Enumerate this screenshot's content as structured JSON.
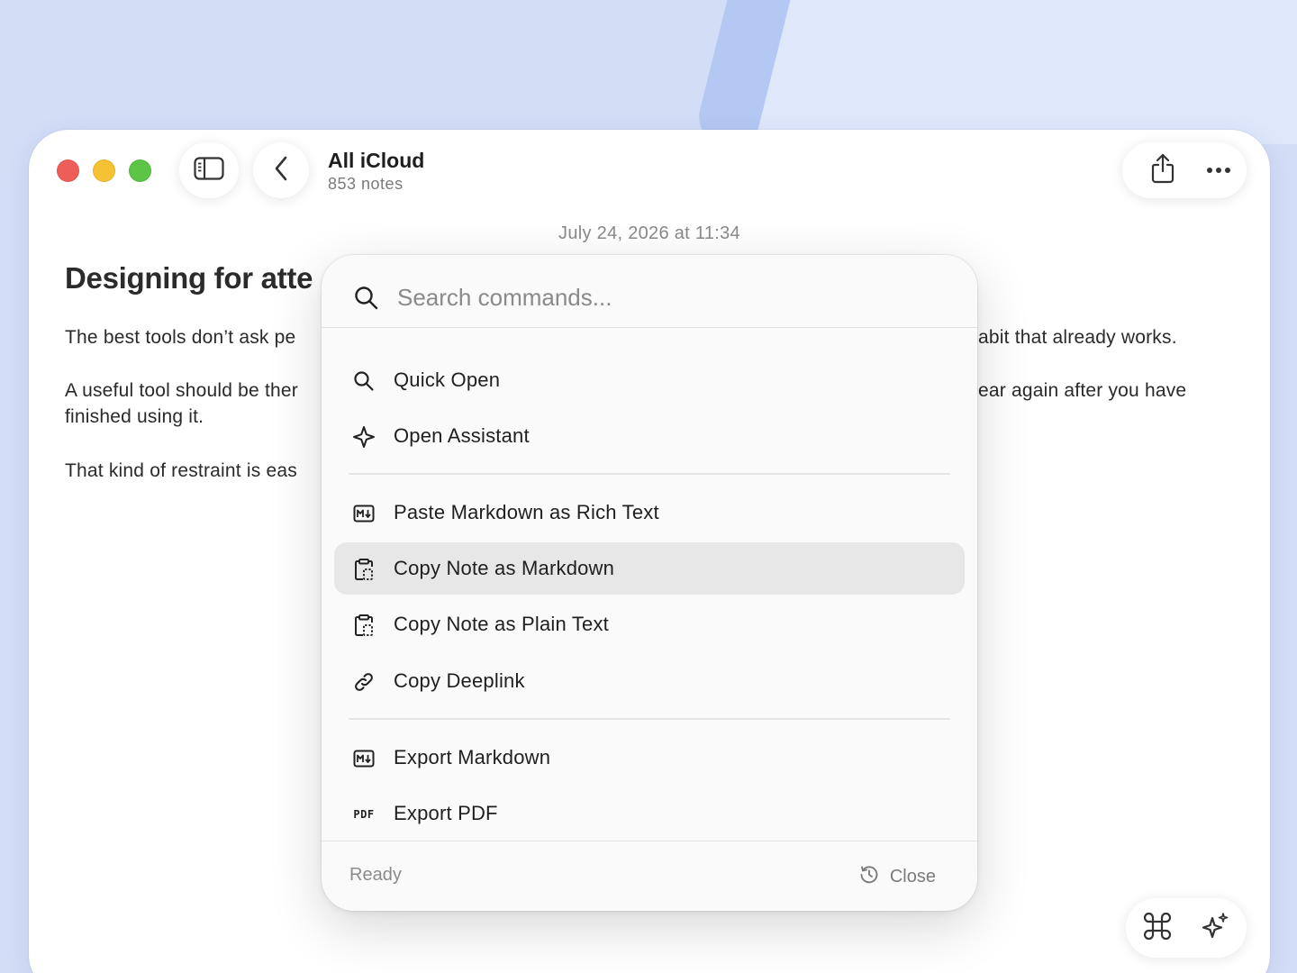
{
  "window": {
    "folder_title": "All iCloud",
    "note_count": "853 notes"
  },
  "note": {
    "date": "July 24, 2026 at 11:34",
    "heading_visible": "Designing for atte",
    "paragraphs": [
      {
        "left": "The best tools don’t ask pe",
        "right": "abit that already works."
      },
      {
        "left": "A useful tool should be ther",
        "right": "ear again after you have",
        "continued": "finished using it."
      },
      {
        "left": "That kind of restraint is eas"
      }
    ]
  },
  "palette": {
    "search_placeholder": "Search commands...",
    "groups": [
      [
        {
          "icon": "search-icon",
          "label": "Quick Open"
        },
        {
          "icon": "sparkle-icon",
          "label": "Open Assistant"
        }
      ],
      [
        {
          "icon": "markdown-icon",
          "label": "Paste Markdown as Rich Text"
        },
        {
          "icon": "clipboard-icon",
          "label": "Copy Note as Markdown",
          "selected": true
        },
        {
          "icon": "clipboard-icon",
          "label": "Copy Note as Plain Text"
        },
        {
          "icon": "link-icon",
          "label": "Copy Deeplink"
        }
      ],
      [
        {
          "icon": "markdown-icon",
          "label": "Export Markdown"
        },
        {
          "icon": "pdf-icon",
          "label": "Export PDF",
          "icon_text": "PDF"
        }
      ]
    ],
    "status": "Ready",
    "close_label": "Close"
  },
  "colors": {
    "background": "#d2ddf6",
    "close_red": "#ed5e58",
    "minimize_yellow": "#f4c232",
    "zoom_green": "#5cc546",
    "selected_row": "#e7e7e7"
  }
}
